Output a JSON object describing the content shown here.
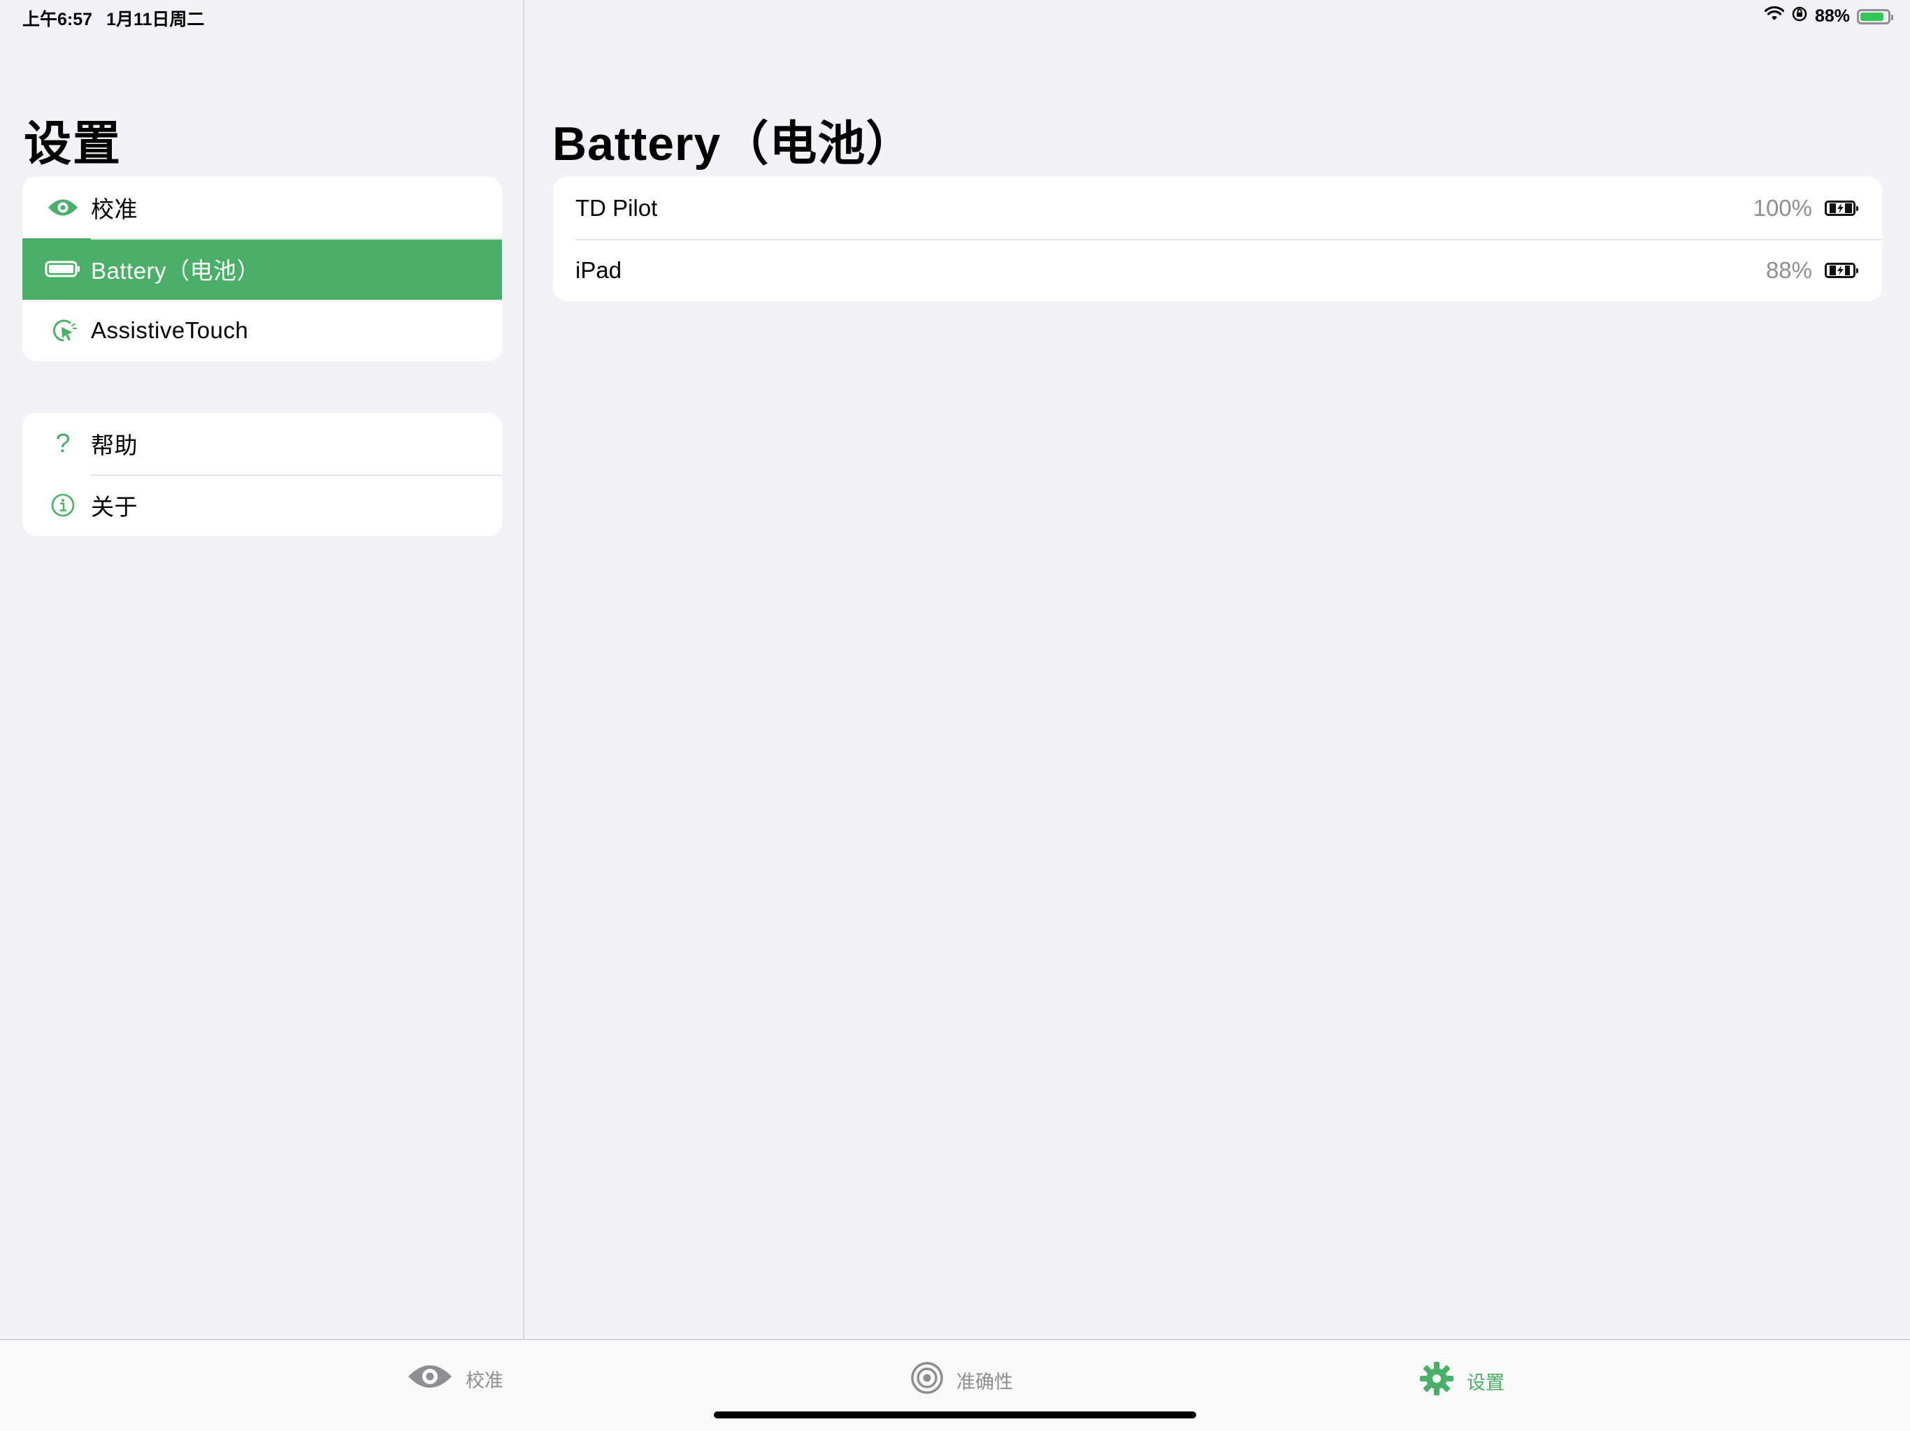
{
  "status_bar": {
    "time": "上午6:57",
    "date": "1月11日周二",
    "battery_text": "88%",
    "battery_level": 0.88,
    "charging": true
  },
  "sidebar": {
    "title": "设置",
    "groups": [
      {
        "items": [
          {
            "label": "校准",
            "icon": "eye-icon",
            "selected": false
          },
          {
            "label": "Battery（电池）",
            "icon": "battery-icon",
            "selected": true
          },
          {
            "label": "AssistiveTouch",
            "icon": "assistive-touch-icon",
            "selected": false
          }
        ]
      },
      {
        "items": [
          {
            "label": "帮助",
            "icon": "question-icon",
            "selected": false,
            "glyph": "?"
          },
          {
            "label": "关于",
            "icon": "info-icon",
            "selected": false
          }
        ]
      }
    ]
  },
  "detail": {
    "title": "Battery（电池）",
    "rows": [
      {
        "name": "TD Pilot",
        "percent": "100%",
        "icon": "battery-charging-icon"
      },
      {
        "name": "iPad",
        "percent": "88%",
        "icon": "battery-charging-icon"
      }
    ]
  },
  "tab_bar": {
    "tabs": [
      {
        "label": "校准",
        "icon": "eye-icon",
        "active": false
      },
      {
        "label": "准确性",
        "icon": "target-icon",
        "active": false
      },
      {
        "label": "设置",
        "icon": "gear-icon",
        "active": true
      }
    ]
  },
  "colors": {
    "accent": "#4caf69",
    "background": "#f2f2f7",
    "secondary_text": "#8e8e93"
  }
}
